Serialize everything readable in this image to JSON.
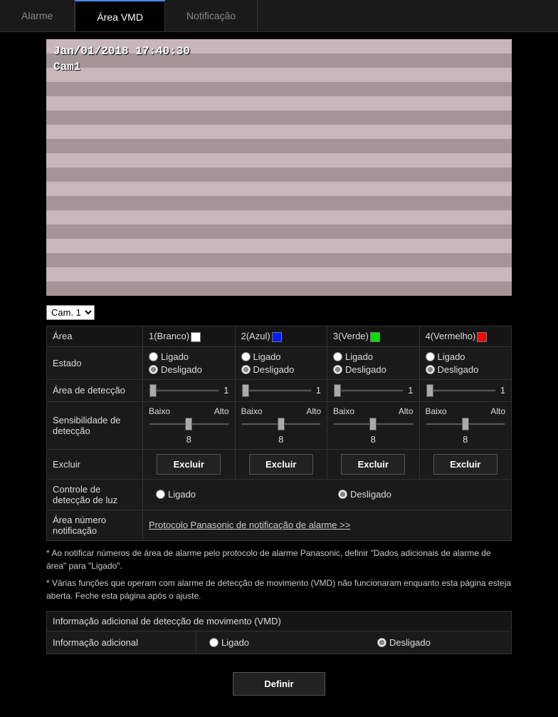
{
  "tabs": {
    "alarm": "Alarme",
    "area_vmd": "Área VMD",
    "notification": "Notificação"
  },
  "preview": {
    "timestamp": "Jan/01/2018 17:40:30",
    "camera": "Cam1"
  },
  "camera_select": {
    "value": "Cam. 1"
  },
  "headers": {
    "area": "Área",
    "state": "Estado",
    "detect_area": "Área de detecção",
    "sensitivity": "Sensibilidade de detecção",
    "exclude": "Excluir",
    "light_control": "Controle de detecção de luz",
    "area_notify": "Área número notificação",
    "add_info_section": "Informação adicional de detecção de movimento (VMD)",
    "add_info": "Informação adicional"
  },
  "areas": [
    {
      "label": "1(Branco)",
      "color": "#ffffff",
      "state": "Desligado",
      "detect": 1,
      "sens": 8
    },
    {
      "label": "2(Azul)",
      "color": "#0020ff",
      "state": "Desligado",
      "detect": 1,
      "sens": 8
    },
    {
      "label": "3(Verde)",
      "color": "#00e000",
      "state": "Desligado",
      "detect": 1,
      "sens": 8
    },
    {
      "label": "4(Vermelho)",
      "color": "#ff0000",
      "state": "Desligado",
      "detect": 1,
      "sens": 8
    }
  ],
  "radio_labels": {
    "on": "Ligado",
    "off": "Desligado",
    "low": "Baixo",
    "high": "Alto"
  },
  "exclude_btn": "Excluir",
  "light_control": "Desligado",
  "notify_link": "Protocolo Panasonic de notificação de alarme >>",
  "notes": {
    "n1": "* Ao notificar números de área de alarme pelo protocolo de alarme Panasonic, definir \"Dados adicionais de alarme de área\" para \"Ligado\".",
    "n2": "* Várias funções que operam com alarme de detecção de movimento (VMD) não funcionaram enquanto esta página esteja aberta. Feche esta página após o ajuste."
  },
  "add_info_state": "Desligado",
  "define_btn": "Definir"
}
